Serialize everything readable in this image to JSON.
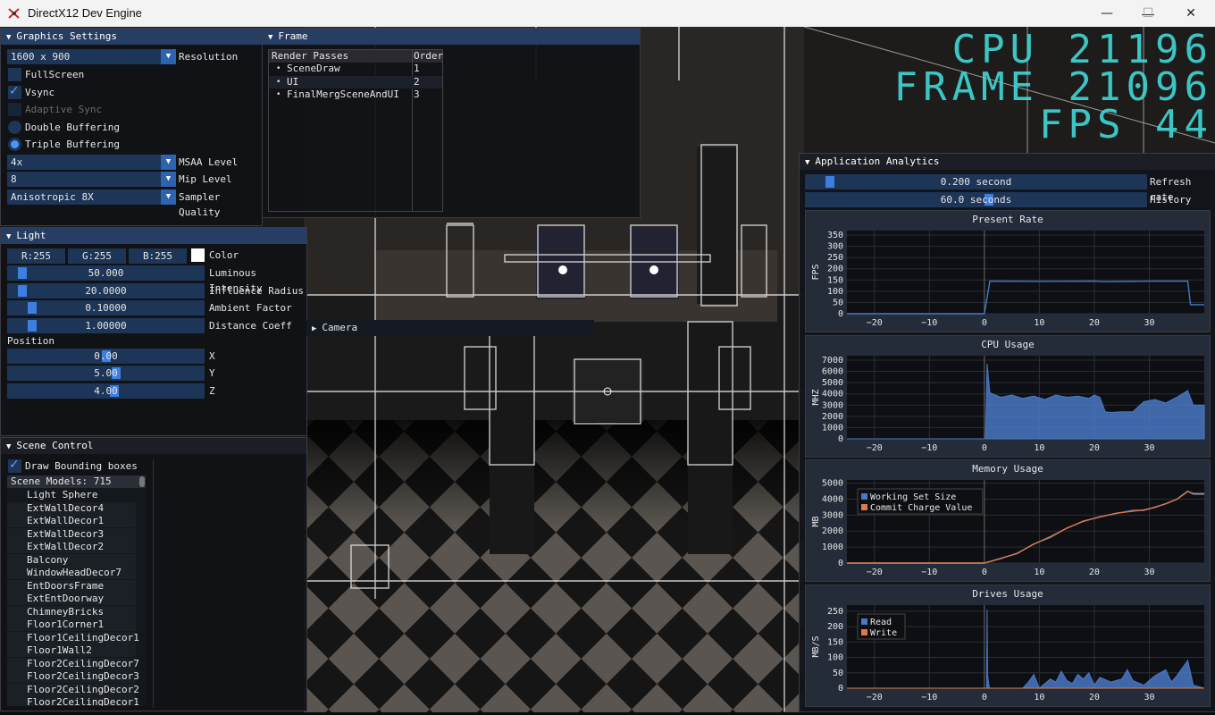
{
  "window": {
    "title": "DirectX12 Dev Engine",
    "minimize": "—",
    "maximize": "☐",
    "close": "✕"
  },
  "overlay": {
    "cpu": "CPU 21196",
    "frame": "FRAME 21096",
    "fps": "FPS 44",
    "color": "#3fd8d8"
  },
  "graphics": {
    "title": "Graphics Settings",
    "resolution_value": "1600 x 900",
    "resolution_label": "Resolution",
    "fullscreen": "FullScreen",
    "vsync": "Vsync",
    "adaptive": "Adaptive Sync",
    "double": "Double Buffering",
    "triple": "Triple Buffering",
    "msaa_value": "4x",
    "msaa_label": "MSAA Level",
    "mip_value": "8",
    "mip_label": "Mip Level",
    "sampler_value": "Anisotropic 8X",
    "sampler_label": "Sampler Quality"
  },
  "frame": {
    "title": "Frame",
    "col1": "Render Passes",
    "col2": "Order",
    "passes": [
      {
        "name": "SceneDraw",
        "order": "1"
      },
      {
        "name": "UI",
        "order": "2"
      },
      {
        "name": "FinalMergSceneAndUI",
        "order": "3"
      }
    ]
  },
  "light": {
    "title": "Light",
    "r": "R:255",
    "g": "G:255",
    "b": "B:255",
    "color_label": "Color",
    "lum_value": "50.000",
    "lum_label": "Luminous Intensity",
    "inf_value": "20.0000",
    "inf_label": "Influence Radius",
    "amb_value": "0.10000",
    "amb_label": "Ambient Factor",
    "dist_value": "1.00000",
    "dist_label": "Distance Coeff",
    "position_label": "Position",
    "x_value": "0.00",
    "y_value": "5.00",
    "z_value": "4.00",
    "x_label": "X",
    "y_label": "Y",
    "z_label": "Z"
  },
  "camera": {
    "title": "Camera"
  },
  "scene": {
    "title": "Scene Control",
    "draw_bb": "Draw Bounding boxes",
    "models_header": "Scene Models: 715",
    "models": [
      "Light Sphere",
      "ExtWallDecor4",
      "ExtWallDecor1",
      "ExtWallDecor3",
      "ExtWallDecor2",
      "Balcony",
      "WindowHeadDecor7",
      "EntDoorsFrame",
      "ExtEntDoorway",
      "ChimneyBricks",
      "Floor1Corner1",
      "Floor1CeilingDecor1",
      "Floor1Wall2",
      "Floor2CeilingDecor7",
      "Floor2CeilingDecor3",
      "Floor2CeilingDecor2",
      "Floor2CeilingDecor1"
    ]
  },
  "analytics": {
    "title": "Application Analytics",
    "refresh_value": "0.200 second",
    "refresh_label": "Refresh rate",
    "refresh_fraction": 0.06,
    "history_value": "60.0 seconds",
    "history_label": "History",
    "history_fraction": 0.55
  },
  "colors": {
    "series_blue": "#4a78c4",
    "series_orange": "#e0794a",
    "panel_header": "#263e63"
  },
  "chart_data": [
    {
      "type": "line",
      "title": "Present Rate",
      "ylabel": "FPS",
      "xlim": [
        -25,
        40
      ],
      "ylim": [
        0,
        370
      ],
      "xticks": [
        "-20",
        "-10",
        "0",
        "10",
        "20",
        "30"
      ],
      "yticks": [
        "0",
        "50",
        "100",
        "150",
        "200",
        "250",
        "300",
        "350"
      ],
      "series": [
        {
          "x": [
            -25,
            -0.2,
            0,
            1,
            10,
            20,
            22,
            30,
            37,
            37.5,
            40
          ],
          "values": [
            0,
            0,
            0,
            145,
            144,
            145,
            143,
            145,
            145,
            40,
            40
          ]
        }
      ]
    },
    {
      "type": "area",
      "title": "CPU Usage",
      "ylabel": "MHZ",
      "xlim": [
        -25,
        40
      ],
      "ylim": [
        0,
        7400
      ],
      "xticks": [
        "-20",
        "-10",
        "0",
        "10",
        "20",
        "30"
      ],
      "yticks": [
        "0",
        "1000",
        "2000",
        "3000",
        "4000",
        "5000",
        "6000",
        "7000"
      ],
      "series": [
        {
          "x": [
            -25,
            0,
            0.2,
            0.5,
            1,
            3,
            5,
            7,
            9,
            11,
            13,
            15,
            17,
            19,
            20,
            21,
            22,
            23,
            25,
            27,
            29,
            31,
            33,
            35,
            37,
            38,
            39,
            40
          ],
          "values": [
            0,
            0,
            0,
            6700,
            4100,
            3700,
            3900,
            3600,
            3800,
            3500,
            3900,
            3700,
            3800,
            3600,
            3900,
            3700,
            2400,
            2350,
            2400,
            2400,
            3300,
            3500,
            3200,
            3700,
            4300,
            3000,
            3000,
            3000
          ]
        }
      ]
    },
    {
      "type": "line",
      "title": "Memory Usage",
      "ylabel": "MB",
      "xlim": [
        -25,
        40
      ],
      "ylim": [
        0,
        5200
      ],
      "xticks": [
        "-20",
        "-10",
        "0",
        "10",
        "20",
        "30"
      ],
      "yticks": [
        "0",
        "1000",
        "2000",
        "3000",
        "4000",
        "5000"
      ],
      "legend": "top-left",
      "series": [
        {
          "name": "Working Set Size",
          "x": [
            -25,
            0,
            3,
            6,
            9,
            12,
            15,
            18,
            21,
            24,
            27,
            29,
            31,
            33,
            35,
            37,
            38,
            40
          ],
          "values": [
            0,
            0,
            300,
            600,
            1200,
            1600,
            2200,
            2600,
            2900,
            3100,
            3300,
            3300,
            3500,
            3700,
            4000,
            4500,
            4300,
            4300
          ]
        },
        {
          "name": "Commit Charge Value",
          "x": [
            -25,
            0,
            3,
            6,
            9,
            12,
            15,
            18,
            21,
            24,
            27,
            29,
            31,
            33,
            35,
            37,
            38,
            40
          ],
          "values": [
            0,
            0,
            280,
            620,
            1180,
            1650,
            2180,
            2620,
            2880,
            3120,
            3250,
            3320,
            3480,
            3720,
            3980,
            4480,
            4350,
            4350
          ]
        }
      ]
    },
    {
      "type": "area",
      "title": "Drives Usage",
      "ylabel": "MB/S",
      "xlim": [
        -25,
        40
      ],
      "ylim": [
        0,
        270
      ],
      "xticks": [
        "-20",
        "-10",
        "0",
        "10",
        "20",
        "30"
      ],
      "yticks": [
        "0",
        "50",
        "100",
        "150",
        "200",
        "250"
      ],
      "legend": "top-left",
      "series": [
        {
          "name": "Read",
          "x": [
            -25,
            0,
            0.4,
            0.5,
            0.6,
            0.9,
            7,
            8,
            9,
            10,
            12,
            13,
            14,
            15,
            16,
            17,
            18,
            19,
            20,
            21,
            23,
            25,
            26,
            27,
            29,
            31,
            33,
            34,
            35,
            37,
            38,
            40
          ],
          "values": [
            0,
            0,
            0,
            255,
            40,
            0,
            0,
            20,
            45,
            0,
            30,
            20,
            55,
            25,
            15,
            45,
            30,
            50,
            10,
            35,
            20,
            30,
            60,
            25,
            10,
            40,
            60,
            20,
            40,
            90,
            10,
            0
          ]
        },
        {
          "name": "Write",
          "x": [
            -25,
            40
          ],
          "values": [
            0,
            0
          ]
        }
      ]
    }
  ]
}
